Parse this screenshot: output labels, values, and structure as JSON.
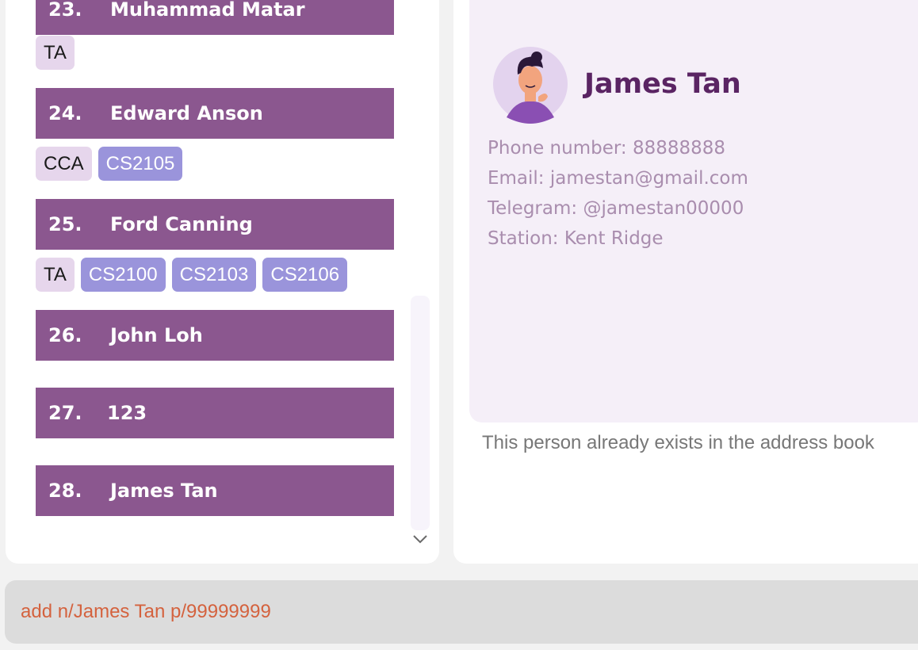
{
  "person_list": [
    {
      "index": "23.",
      "name": "Muhammad Matar",
      "tags": [
        {
          "label": "TA",
          "kind": "role"
        }
      ]
    },
    {
      "index": "24.",
      "name": "Edward Anson",
      "tags": [
        {
          "label": "CCA",
          "kind": "role"
        },
        {
          "label": "CS2105",
          "kind": "mod"
        }
      ]
    },
    {
      "index": "25.",
      "name": "Ford Canning",
      "tags": [
        {
          "label": "TA",
          "kind": "role"
        },
        {
          "label": "CS2100",
          "kind": "mod"
        },
        {
          "label": "CS2103",
          "kind": "mod"
        },
        {
          "label": "CS2106",
          "kind": "mod"
        }
      ]
    },
    {
      "index": "26.",
      "name": "John Loh",
      "tags": []
    },
    {
      "index": "27.",
      "name": "123",
      "tags": []
    },
    {
      "index": "28.",
      "name": "James Tan",
      "tags": []
    }
  ],
  "detail": {
    "name": "James Tan",
    "phone": "Phone number: 88888888",
    "email": "Email: jamestan@gmail.com",
    "telegram": "Telegram: @jamestan00000",
    "station": "Station: Kent Ridge"
  },
  "result_message": "This person already exists in the address book",
  "command_input": "add n/James Tan p/99999999",
  "colors": {
    "header_bg": "#8b578f",
    "role_tag_bg": "#e6d6ec",
    "module_tag_bg": "#9a94db",
    "detail_name": "#5a2463",
    "command_text": "#d4623e"
  },
  "icons": {
    "scroll_down": "chevron-down-icon",
    "avatar": "avatar"
  }
}
